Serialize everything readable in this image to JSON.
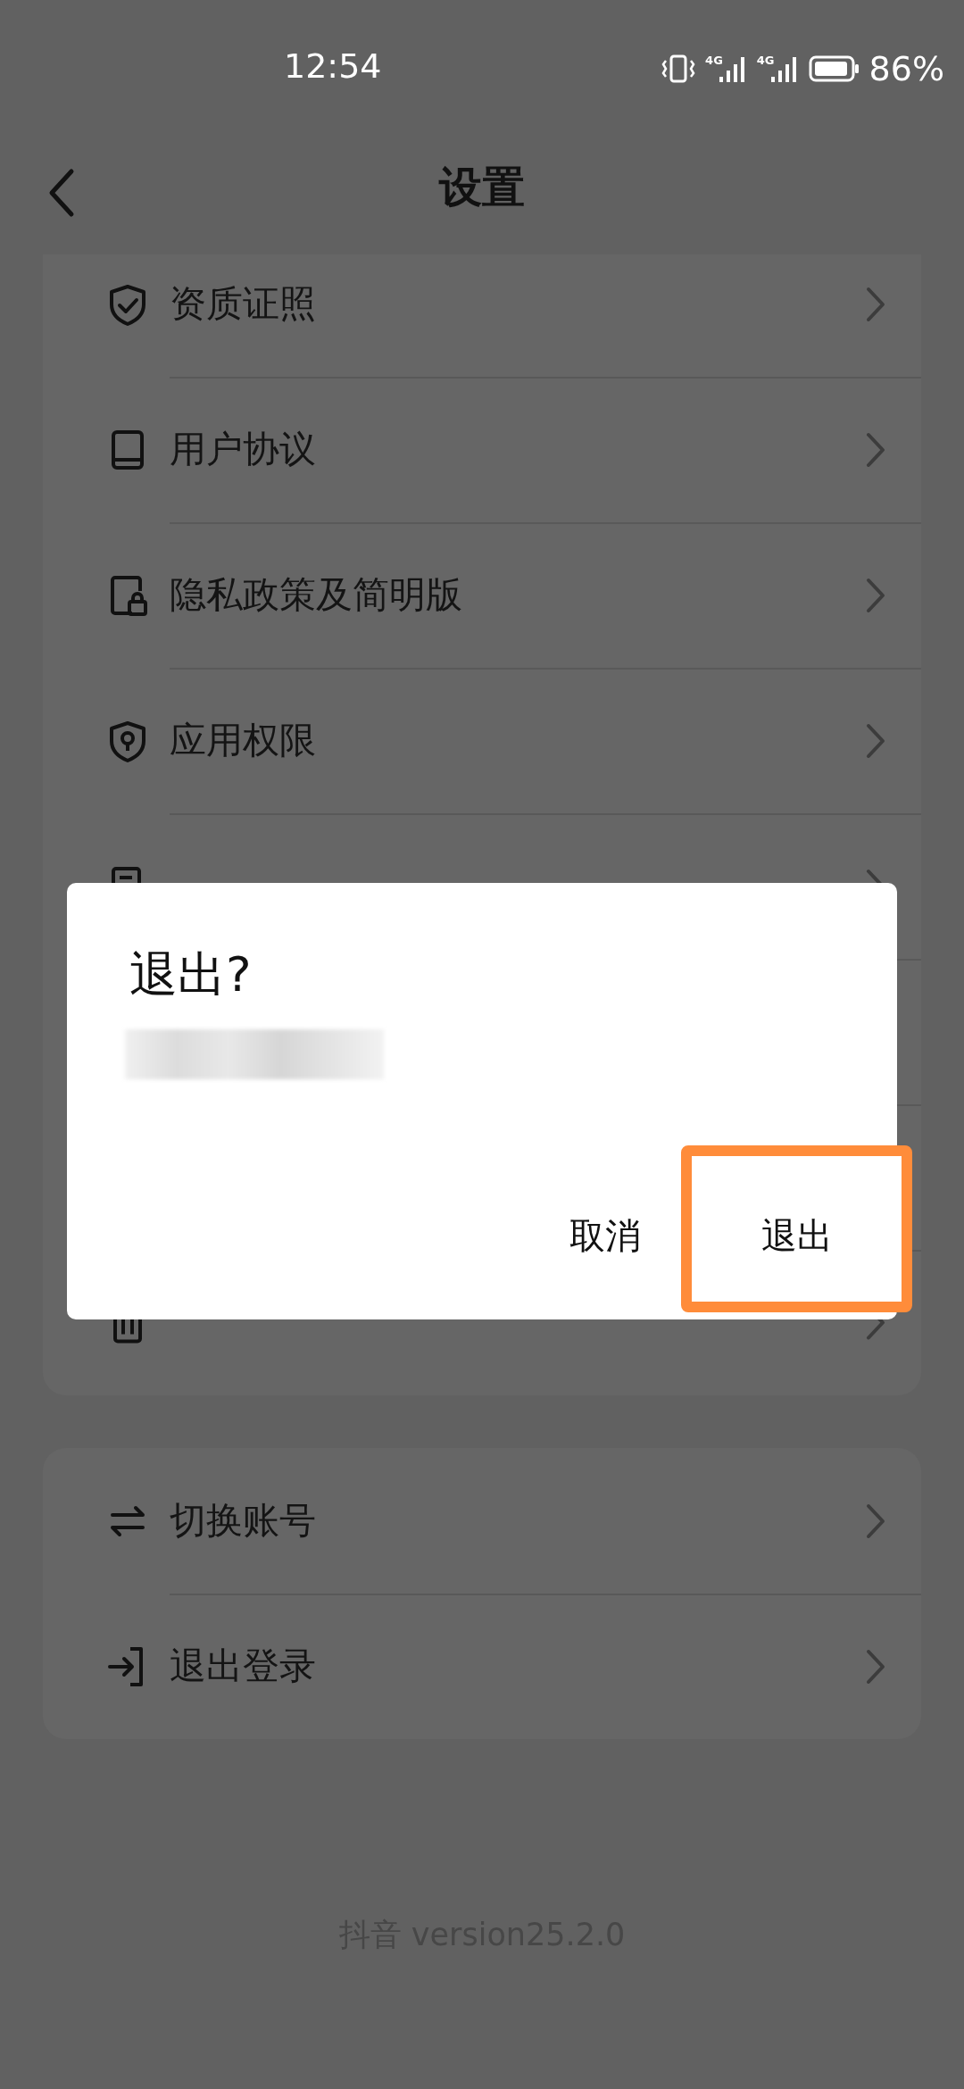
{
  "status_bar": {
    "time": "12:54",
    "network_labels": [
      "4G",
      "4G"
    ],
    "battery": "86%"
  },
  "header": {
    "title": "设置"
  },
  "settings_group_1": [
    {
      "label": "资质证照"
    },
    {
      "label": "用户协议"
    },
    {
      "label": "隐私政策及简明版"
    },
    {
      "label": "应用权限"
    }
  ],
  "settings_group_2": [
    {
      "label": "切换账号"
    },
    {
      "label": "退出登录"
    }
  ],
  "footer": "抖音 version25.2.0",
  "dialog": {
    "title": "退出?",
    "buttons": [
      {
        "label": "取消",
        "highlighted": false
      },
      {
        "label": "退出",
        "highlighted": true
      }
    ]
  }
}
